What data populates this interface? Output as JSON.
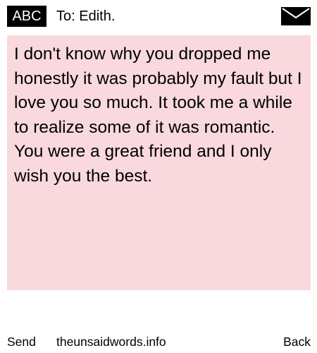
{
  "header": {
    "badge_label": "ABC",
    "recipient": "To: Edith.",
    "envelope_icon": "envelope-icon"
  },
  "message": {
    "text": "I don't know why you dropped me honestly it was probably my fault but I love you so much. It took me a while to realize some of it was romantic. You were a great friend and I only wish you the best.",
    "background_color": "#f9d9dd"
  },
  "footer": {
    "send_label": "Send",
    "site_label": "theunsaidwords.info",
    "back_label": "Back"
  }
}
